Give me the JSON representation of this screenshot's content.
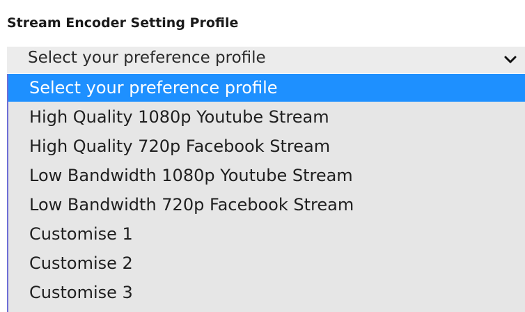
{
  "section": {
    "label": "Stream Encoder Setting Profile"
  },
  "select": {
    "value": "Select your preference profile",
    "chevron_icon": "chevron-down-icon"
  },
  "dropdown": {
    "options": [
      {
        "label": "Select your preference profile",
        "highlighted": true
      },
      {
        "label": "High Quality 1080p Youtube Stream",
        "highlighted": false
      },
      {
        "label": "High Quality 720p Facebook Stream",
        "highlighted": false
      },
      {
        "label": "Low Bandwidth 1080p Youtube Stream",
        "highlighted": false
      },
      {
        "label": "Low Bandwidth 720p Facebook Stream",
        "highlighted": false
      },
      {
        "label": "Customise 1",
        "highlighted": false
      },
      {
        "label": "Customise 2",
        "highlighted": false
      },
      {
        "label": "Customise 3",
        "highlighted": false
      }
    ]
  },
  "colors": {
    "highlight": "#1e90ff",
    "list_background": "#e6e6e6",
    "select_background": "#ececec",
    "list_border": "#6f6fd6"
  }
}
